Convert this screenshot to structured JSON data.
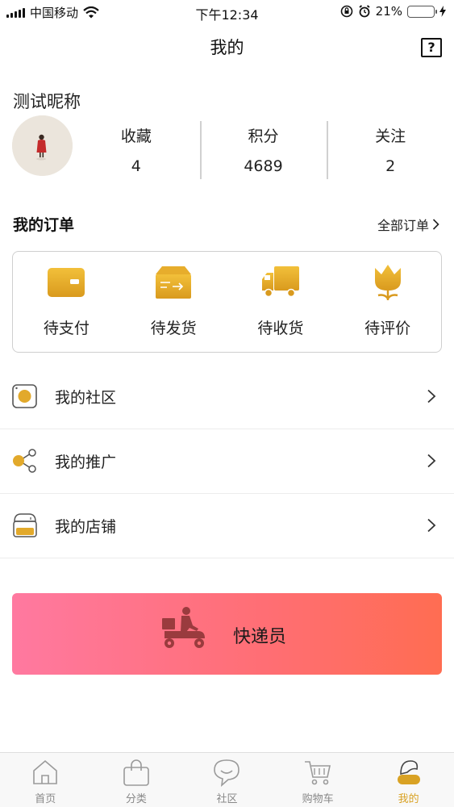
{
  "status_bar": {
    "carrier": "中国移动",
    "time": "下午12:34",
    "battery_percent": "21%",
    "battery_level": 0.21
  },
  "nav": {
    "title": "我的",
    "help_icon": "help-square-icon",
    "help_glyph": "?"
  },
  "profile": {
    "nickname": "测试昵称",
    "stats": [
      {
        "label": "收藏",
        "value": "4"
      },
      {
        "label": "积分",
        "value": "4689"
      },
      {
        "label": "关注",
        "value": "2"
      }
    ]
  },
  "orders": {
    "title": "我的订单",
    "all_label": "全部订单",
    "items": [
      {
        "label": "待支付",
        "icon": "wallet-icon"
      },
      {
        "label": "待发货",
        "icon": "package-icon"
      },
      {
        "label": "待收货",
        "icon": "delivery-truck-icon"
      },
      {
        "label": "待评价",
        "icon": "flower-icon"
      }
    ]
  },
  "menu": [
    {
      "label": "我的社区",
      "icon": "community-icon"
    },
    {
      "label": "我的推广",
      "icon": "share-icon"
    },
    {
      "label": "我的店铺",
      "icon": "store-icon"
    }
  ],
  "courier": {
    "label": "快递员",
    "icon": "scooter-courier-icon"
  },
  "tabs": [
    {
      "label": "首页",
      "icon": "home-icon",
      "active": false
    },
    {
      "label": "分类",
      "icon": "bag-icon",
      "active": false
    },
    {
      "label": "社区",
      "icon": "chat-bubble-icon",
      "active": false
    },
    {
      "label": "购物车",
      "icon": "cart-icon",
      "active": false
    },
    {
      "label": "我的",
      "icon": "profile-icon",
      "active": true
    }
  ],
  "colors": {
    "accent_gold": "#d9a224",
    "courier_gradient_start": "#ff79a0",
    "courier_gradient_end": "#ff6d52",
    "battery_green": "#43c043"
  }
}
